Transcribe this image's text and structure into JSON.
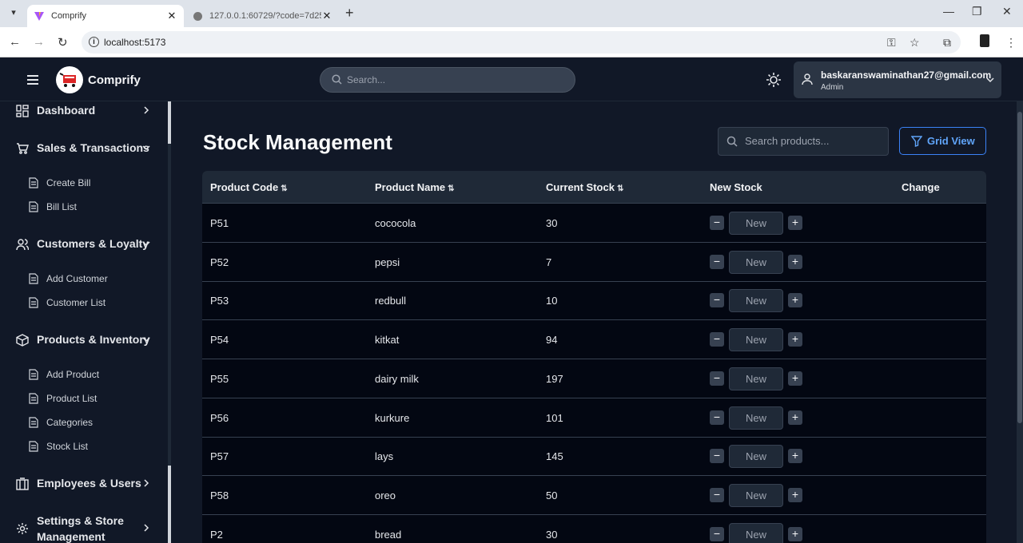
{
  "browser": {
    "tabs": [
      {
        "title": "Comprify",
        "active": true
      },
      {
        "title": "127.0.0.1:60729/?code=7d2514",
        "active": false
      }
    ],
    "url": "localhost:5173"
  },
  "header": {
    "brand": "Comprify",
    "search_placeholder": "Search...",
    "user_email": "baskaranswaminathan27@gmail.com",
    "user_role": "Admin"
  },
  "sidebar": {
    "dashboard": "Dashboard",
    "sales": "Sales & Transactions",
    "sales_items": [
      "Create Bill",
      "Bill List"
    ],
    "customers": "Customers & Loyalty",
    "customer_items": [
      "Add Customer",
      "Customer List"
    ],
    "products": "Products & Inventory",
    "product_items": [
      "Add Product",
      "Product List",
      "Categories",
      "Stock List"
    ],
    "employees": "Employees & Users",
    "settings_line1": "Settings & Store",
    "settings_line2": "Management"
  },
  "main": {
    "title": "Stock Management",
    "search_placeholder": "Search products...",
    "grid_view_label": "Grid View",
    "columns": [
      "Product Code",
      "Product Name",
      "Current Stock",
      "New Stock",
      "Change"
    ],
    "input_placeholder": "New",
    "rows": [
      {
        "code": "P51",
        "name": "cococola",
        "stock": "30"
      },
      {
        "code": "P52",
        "name": "pepsi",
        "stock": "7"
      },
      {
        "code": "P53",
        "name": "redbull",
        "stock": "10"
      },
      {
        "code": "P54",
        "name": "kitkat",
        "stock": "94"
      },
      {
        "code": "P55",
        "name": "dairy milk",
        "stock": "197"
      },
      {
        "code": "P56",
        "name": "kurkure",
        "stock": "101"
      },
      {
        "code": "P57",
        "name": "lays",
        "stock": "145"
      },
      {
        "code": "P58",
        "name": "oreo",
        "stock": "50"
      },
      {
        "code": "P2",
        "name": "bread",
        "stock": "30"
      }
    ]
  },
  "colors": {
    "accent": "#3b82f6",
    "background": "#111827",
    "table_bg": "#030712"
  }
}
